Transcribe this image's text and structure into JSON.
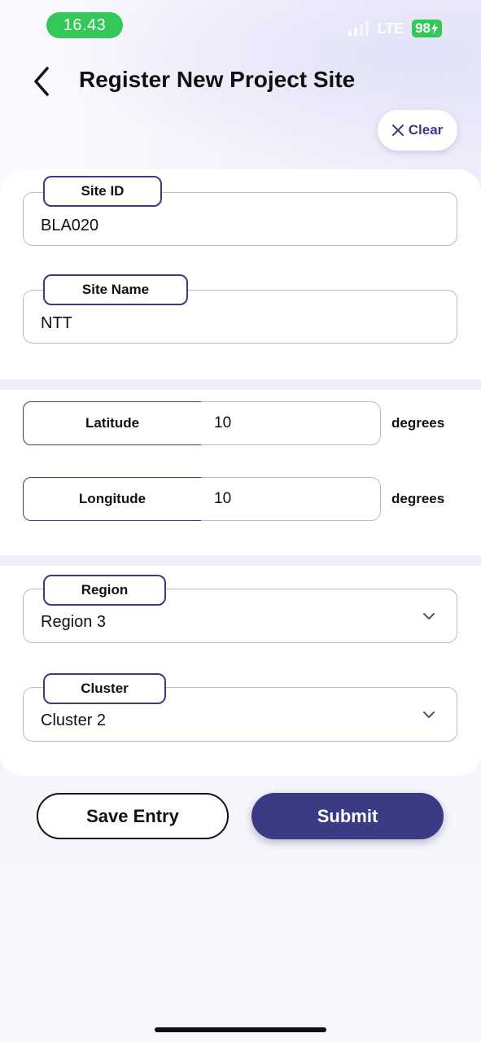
{
  "status_bar": {
    "time": "16.43",
    "network": "LTE",
    "battery": "98"
  },
  "header": {
    "title": "Register New Project Site",
    "back_icon": "chevron-left-icon"
  },
  "clear_button": {
    "label": "Clear",
    "icon": "close-icon"
  },
  "fields": {
    "site_id": {
      "label": "Site ID",
      "value": "BLA020"
    },
    "site_name": {
      "label": "Site Name",
      "value": "NTT"
    },
    "latitude": {
      "label": "Latitude",
      "value": "10",
      "unit": "degrees"
    },
    "longitude": {
      "label": "Longitude",
      "value": "10",
      "unit": "degrees"
    },
    "region": {
      "label": "Region",
      "value": "Region 3"
    },
    "cluster": {
      "label": "Cluster",
      "value": "Cluster 2"
    }
  },
  "actions": {
    "save_label": "Save Entry",
    "submit_label": "Submit"
  },
  "colors": {
    "accent": "#3b3a85",
    "status_green": "#34c759",
    "field_border": "#b9b9d4"
  }
}
